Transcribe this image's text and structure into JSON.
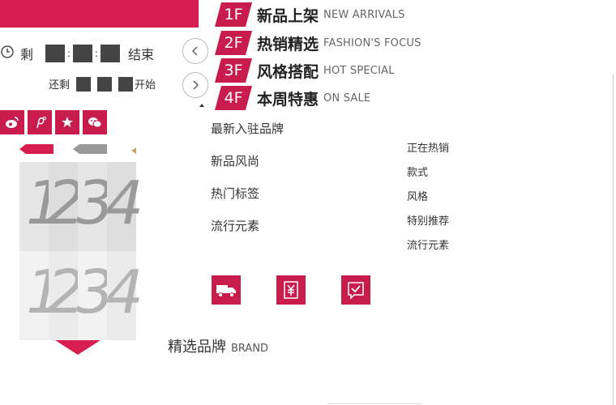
{
  "countdown": {
    "prefix": "剩",
    "suffix": "结束",
    "prefix2": "还剩",
    "suffix2": "开始",
    "colon": ":"
  },
  "nav": {
    "prev_icon": "chevron-left-icon",
    "next_icon": "chevron-right-icon"
  },
  "share_icons": [
    "weibo-icon",
    "pinterest-icon",
    "star-icon",
    "wechat-icon"
  ],
  "floors": [
    {
      "num": "1F",
      "cn": "新品上架",
      "en": "NEW ARRIVALS"
    },
    {
      "num": "2F",
      "cn": "热销精选",
      "en": "FASHION'S FOCUS"
    },
    {
      "num": "3F",
      "cn": "风格搭配",
      "en": "HOT SPECIAL"
    },
    {
      "num": "4F",
      "cn": "本周特惠",
      "en": "ON SALE"
    }
  ],
  "menu_left": [
    "最新入驻品牌",
    "新品风尚",
    "热门标签",
    "流行元素"
  ],
  "menu_right": [
    "正在热销",
    "款式",
    "风格",
    "特别推荐",
    "流行元素"
  ],
  "digits": [
    "1",
    "2",
    "3",
    "4"
  ],
  "service_icons": [
    "delivery-truck-icon",
    "yuan-receipt-icon",
    "return-check-icon"
  ],
  "brand": {
    "cn": "精选品牌",
    "en": "BRAND"
  },
  "colors": {
    "accent": "#d81e50",
    "dark": "#444444",
    "gray": "#999999"
  }
}
